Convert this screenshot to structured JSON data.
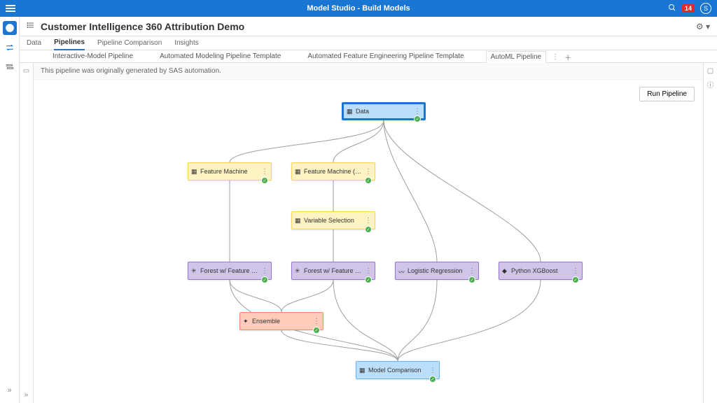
{
  "topbar": {
    "title": "Model Studio - Build Models",
    "notif_count": "14",
    "user_initial": "S"
  },
  "header": {
    "title": "Customer Intelligence 360 Attribution Demo"
  },
  "main_tabs": [
    "Data",
    "Pipelines",
    "Pipeline Comparison",
    "Insights"
  ],
  "main_tab_active": 1,
  "sub_tabs": [
    "Interactive-Model Pipeline",
    "Automated Modeling Pipeline Template",
    "Automated Feature Engineering Pipeline Template",
    "AutoML Pipeline"
  ],
  "sub_tab_active": 3,
  "info_text": "This pipeline was originally generated by SAS automation.",
  "run_button": "Run Pipeline",
  "nodes": {
    "data": {
      "label": "Data"
    },
    "fm": {
      "label": "Feature Machine"
    },
    "fmvs": {
      "label": "Feature Machine (w/ VS)"
    },
    "vs": {
      "label": "Variable Selection"
    },
    "forest1": {
      "label": "Forest w/ Feature Machines"
    },
    "forest2": {
      "label": "Forest w/ Feature Machin..."
    },
    "logreg": {
      "label": "Logistic Regression"
    },
    "xgb": {
      "label": "Python XGBoost"
    },
    "ensemble": {
      "label": "Ensemble"
    },
    "modelcomp": {
      "label": "Model Comparison"
    }
  }
}
